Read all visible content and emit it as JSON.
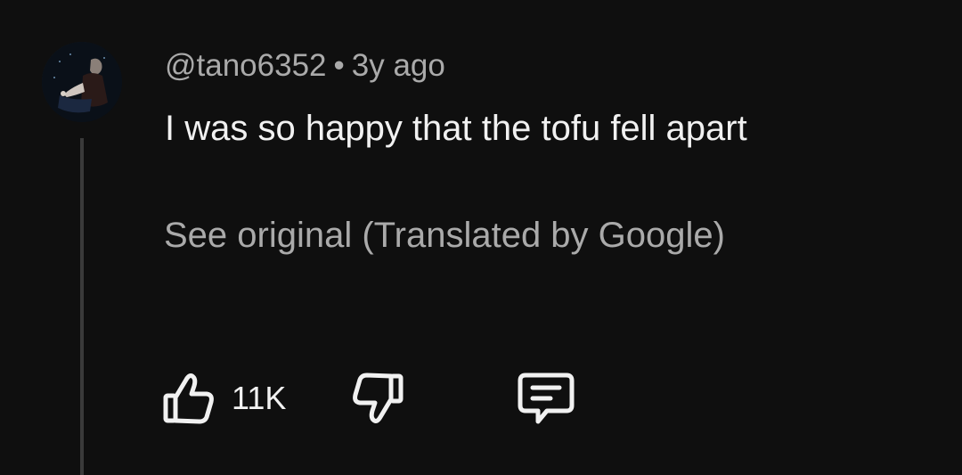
{
  "comment": {
    "author": "@tano6352",
    "separator": "•",
    "time": "3y ago",
    "text": "I was so happy that the tofu fell apart",
    "see_original": "See original (Translated by Google)",
    "likes": "11K"
  },
  "icons": {
    "like": "thumbs-up-icon",
    "dislike": "thumbs-down-icon",
    "reply": "comment-icon"
  },
  "colors": {
    "background": "#0f0f0f",
    "primary_text": "#f1f1f1",
    "secondary_text": "#aaaaaa"
  }
}
